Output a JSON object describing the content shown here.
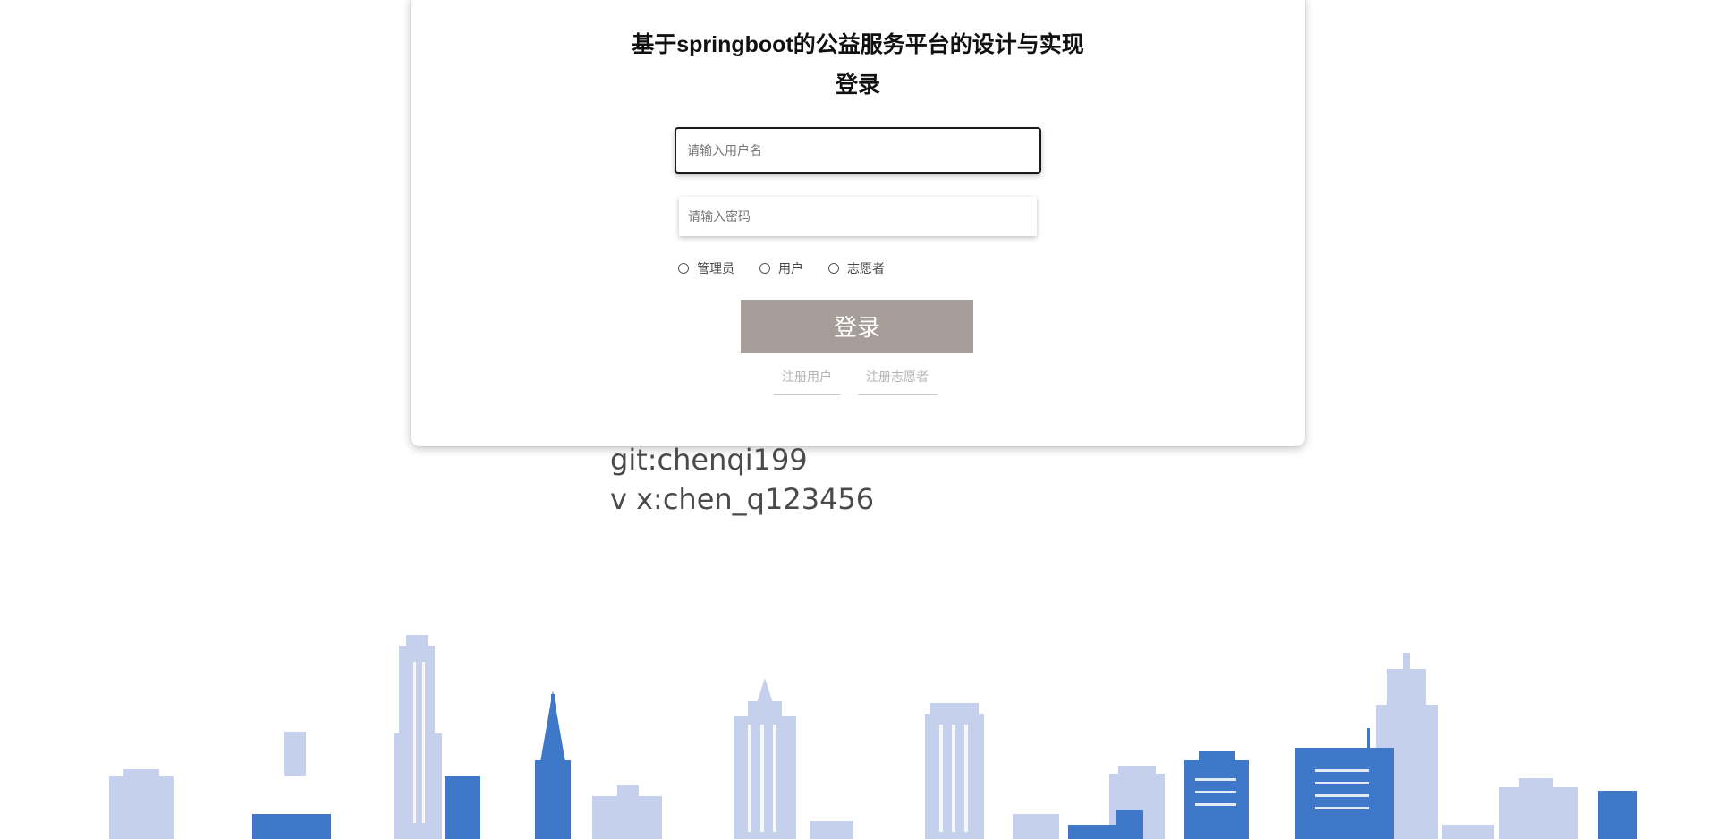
{
  "login": {
    "title": "基于springboot的公益服务平台的设计与实现",
    "subtitle": "登录",
    "username_placeholder": "请输入用户名",
    "password_placeholder": "请输入密码",
    "roles": [
      "管理员",
      "用户",
      "志愿者"
    ],
    "login_button": "登录",
    "register_user_link": "注册用户",
    "register_volunteer_link": "注册志愿者"
  },
  "info": {
    "git": "git:chenqi199",
    "vx": "v x:chen_q123456"
  },
  "colors": {
    "button_bg": "#a69d98",
    "skyline_light": "#c5d1ec",
    "skyline_dark": "#3f78c8"
  }
}
